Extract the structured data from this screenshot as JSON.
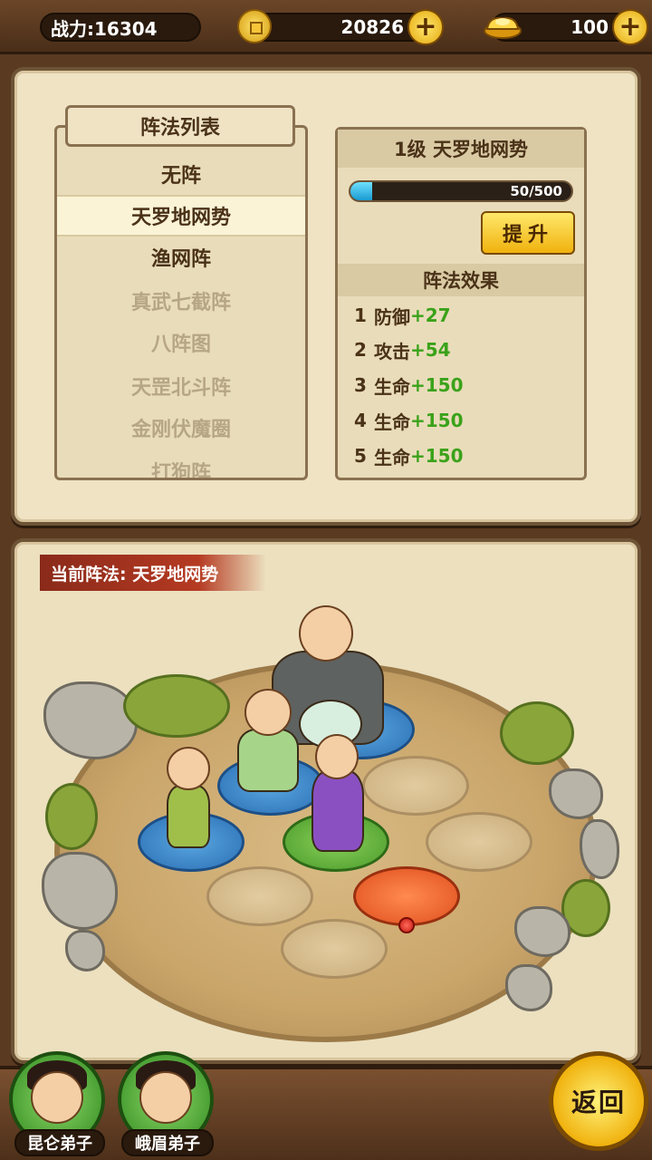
{
  "topbar": {
    "power_label": "战力:16304",
    "coins": "20826",
    "gold": "100"
  },
  "formation_list": {
    "title": "阵法列表",
    "items": [
      {
        "label": "无阵",
        "state": "unlocked"
      },
      {
        "label": "天罗地网势",
        "state": "selected"
      },
      {
        "label": "渔网阵",
        "state": "unlocked"
      },
      {
        "label": "真武七截阵",
        "state": "locked"
      },
      {
        "label": "八阵图",
        "state": "locked"
      },
      {
        "label": "天罡北斗阵",
        "state": "locked"
      },
      {
        "label": "金刚伏魔圈",
        "state": "locked"
      },
      {
        "label": "打狗阵",
        "state": "locked"
      }
    ]
  },
  "formation_detail": {
    "header": "1级 天罗地网势",
    "progress_text": "50/500",
    "progress_fraction": 0.1,
    "upgrade_label": "提升",
    "effects_title": "阵法效果",
    "effects": [
      {
        "index": "1",
        "stat": "防御",
        "bonus": "+27"
      },
      {
        "index": "2",
        "stat": "攻击",
        "bonus": "+54"
      },
      {
        "index": "3",
        "stat": "生命",
        "bonus": "+150"
      },
      {
        "index": "4",
        "stat": "生命",
        "bonus": "+150"
      },
      {
        "index": "5",
        "stat": "生命",
        "bonus": "+150"
      }
    ]
  },
  "arena": {
    "current_formation_label": "当前阵法: 天罗地网势"
  },
  "bottombar": {
    "disciples": [
      {
        "label": "昆仑弟子"
      },
      {
        "label": "峨眉弟子"
      }
    ],
    "back_label": "返回"
  },
  "colors": {
    "accent_gold": "#f0b20e",
    "bonus_green": "#3aa21a",
    "progress_blue": "#1a9ad0"
  }
}
